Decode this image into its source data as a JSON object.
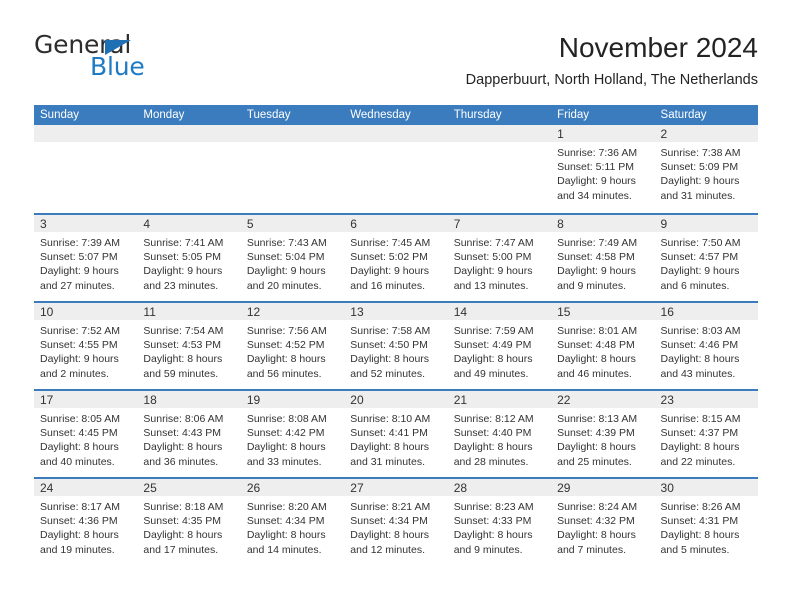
{
  "brand": {
    "name_top": "General",
    "name_bottom": "Blue",
    "triangle_color": "#1f6fb5",
    "blue_color": "#1f7ac4"
  },
  "header": {
    "title": "November 2024",
    "subtitle": "Dapperbuurt, North Holland, The Netherlands"
  },
  "theme": {
    "header_blue": "#3a7cbd",
    "day_band_gray": "#eeeeee",
    "text_color": "#333333"
  },
  "weekdays": [
    "Sunday",
    "Monday",
    "Tuesday",
    "Wednesday",
    "Thursday",
    "Friday",
    "Saturday"
  ],
  "weeks": [
    [
      {
        "day": "",
        "lines": []
      },
      {
        "day": "",
        "lines": []
      },
      {
        "day": "",
        "lines": []
      },
      {
        "day": "",
        "lines": []
      },
      {
        "day": "",
        "lines": []
      },
      {
        "day": "1",
        "lines": [
          "Sunrise: 7:36 AM",
          "Sunset: 5:11 PM",
          "Daylight: 9 hours",
          "and 34 minutes."
        ]
      },
      {
        "day": "2",
        "lines": [
          "Sunrise: 7:38 AM",
          "Sunset: 5:09 PM",
          "Daylight: 9 hours",
          "and 31 minutes."
        ]
      }
    ],
    [
      {
        "day": "3",
        "lines": [
          "Sunrise: 7:39 AM",
          "Sunset: 5:07 PM",
          "Daylight: 9 hours",
          "and 27 minutes."
        ]
      },
      {
        "day": "4",
        "lines": [
          "Sunrise: 7:41 AM",
          "Sunset: 5:05 PM",
          "Daylight: 9 hours",
          "and 23 minutes."
        ]
      },
      {
        "day": "5",
        "lines": [
          "Sunrise: 7:43 AM",
          "Sunset: 5:04 PM",
          "Daylight: 9 hours",
          "and 20 minutes."
        ]
      },
      {
        "day": "6",
        "lines": [
          "Sunrise: 7:45 AM",
          "Sunset: 5:02 PM",
          "Daylight: 9 hours",
          "and 16 minutes."
        ]
      },
      {
        "day": "7",
        "lines": [
          "Sunrise: 7:47 AM",
          "Sunset: 5:00 PM",
          "Daylight: 9 hours",
          "and 13 minutes."
        ]
      },
      {
        "day": "8",
        "lines": [
          "Sunrise: 7:49 AM",
          "Sunset: 4:58 PM",
          "Daylight: 9 hours",
          "and 9 minutes."
        ]
      },
      {
        "day": "9",
        "lines": [
          "Sunrise: 7:50 AM",
          "Sunset: 4:57 PM",
          "Daylight: 9 hours",
          "and 6 minutes."
        ]
      }
    ],
    [
      {
        "day": "10",
        "lines": [
          "Sunrise: 7:52 AM",
          "Sunset: 4:55 PM",
          "Daylight: 9 hours",
          "and 2 minutes."
        ]
      },
      {
        "day": "11",
        "lines": [
          "Sunrise: 7:54 AM",
          "Sunset: 4:53 PM",
          "Daylight: 8 hours",
          "and 59 minutes."
        ]
      },
      {
        "day": "12",
        "lines": [
          "Sunrise: 7:56 AM",
          "Sunset: 4:52 PM",
          "Daylight: 8 hours",
          "and 56 minutes."
        ]
      },
      {
        "day": "13",
        "lines": [
          "Sunrise: 7:58 AM",
          "Sunset: 4:50 PM",
          "Daylight: 8 hours",
          "and 52 minutes."
        ]
      },
      {
        "day": "14",
        "lines": [
          "Sunrise: 7:59 AM",
          "Sunset: 4:49 PM",
          "Daylight: 8 hours",
          "and 49 minutes."
        ]
      },
      {
        "day": "15",
        "lines": [
          "Sunrise: 8:01 AM",
          "Sunset: 4:48 PM",
          "Daylight: 8 hours",
          "and 46 minutes."
        ]
      },
      {
        "day": "16",
        "lines": [
          "Sunrise: 8:03 AM",
          "Sunset: 4:46 PM",
          "Daylight: 8 hours",
          "and 43 minutes."
        ]
      }
    ],
    [
      {
        "day": "17",
        "lines": [
          "Sunrise: 8:05 AM",
          "Sunset: 4:45 PM",
          "Daylight: 8 hours",
          "and 40 minutes."
        ]
      },
      {
        "day": "18",
        "lines": [
          "Sunrise: 8:06 AM",
          "Sunset: 4:43 PM",
          "Daylight: 8 hours",
          "and 36 minutes."
        ]
      },
      {
        "day": "19",
        "lines": [
          "Sunrise: 8:08 AM",
          "Sunset: 4:42 PM",
          "Daylight: 8 hours",
          "and 33 minutes."
        ]
      },
      {
        "day": "20",
        "lines": [
          "Sunrise: 8:10 AM",
          "Sunset: 4:41 PM",
          "Daylight: 8 hours",
          "and 31 minutes."
        ]
      },
      {
        "day": "21",
        "lines": [
          "Sunrise: 8:12 AM",
          "Sunset: 4:40 PM",
          "Daylight: 8 hours",
          "and 28 minutes."
        ]
      },
      {
        "day": "22",
        "lines": [
          "Sunrise: 8:13 AM",
          "Sunset: 4:39 PM",
          "Daylight: 8 hours",
          "and 25 minutes."
        ]
      },
      {
        "day": "23",
        "lines": [
          "Sunrise: 8:15 AM",
          "Sunset: 4:37 PM",
          "Daylight: 8 hours",
          "and 22 minutes."
        ]
      }
    ],
    [
      {
        "day": "24",
        "lines": [
          "Sunrise: 8:17 AM",
          "Sunset: 4:36 PM",
          "Daylight: 8 hours",
          "and 19 minutes."
        ]
      },
      {
        "day": "25",
        "lines": [
          "Sunrise: 8:18 AM",
          "Sunset: 4:35 PM",
          "Daylight: 8 hours",
          "and 17 minutes."
        ]
      },
      {
        "day": "26",
        "lines": [
          "Sunrise: 8:20 AM",
          "Sunset: 4:34 PM",
          "Daylight: 8 hours",
          "and 14 minutes."
        ]
      },
      {
        "day": "27",
        "lines": [
          "Sunrise: 8:21 AM",
          "Sunset: 4:34 PM",
          "Daylight: 8 hours",
          "and 12 minutes."
        ]
      },
      {
        "day": "28",
        "lines": [
          "Sunrise: 8:23 AM",
          "Sunset: 4:33 PM",
          "Daylight: 8 hours",
          "and 9 minutes."
        ]
      },
      {
        "day": "29",
        "lines": [
          "Sunrise: 8:24 AM",
          "Sunset: 4:32 PM",
          "Daylight: 8 hours",
          "and 7 minutes."
        ]
      },
      {
        "day": "30",
        "lines": [
          "Sunrise: 8:26 AM",
          "Sunset: 4:31 PM",
          "Daylight: 8 hours",
          "and 5 minutes."
        ]
      }
    ]
  ]
}
